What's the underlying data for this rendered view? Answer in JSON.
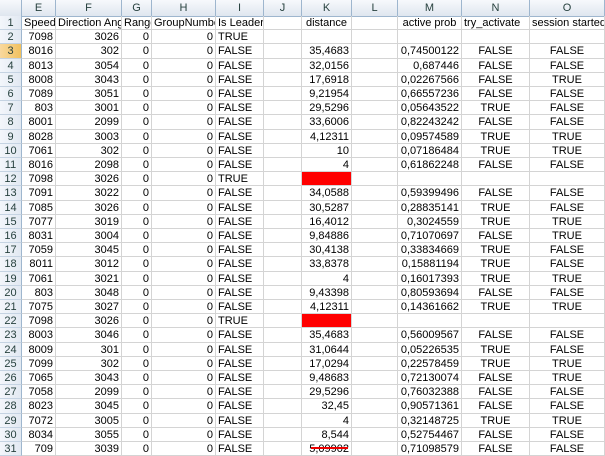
{
  "columns": [
    "E",
    "F",
    "G",
    "H",
    "I",
    "J",
    "K",
    "L",
    "M",
    "N",
    "O"
  ],
  "rows": [
    {
      "n": "1",
      "E": "Speed",
      "F": "Direction Ang",
      "G": "Range",
      "H": "GroupNumber",
      "I": "Is Leader",
      "J": "",
      "K": "distance",
      "L": "",
      "M": "active prob",
      "N": "try_activate",
      "O": "session started",
      "header": true
    },
    {
      "n": "2",
      "E": "7098",
      "F": "3026",
      "G": "0",
      "H": "0",
      "I": "TRUE",
      "J": "",
      "K": "",
      "L": "",
      "M": "",
      "N": "",
      "O": ""
    },
    {
      "n": "3",
      "E": "8016",
      "F": "302",
      "G": "0",
      "H": "0",
      "I": "FALSE",
      "J": "",
      "K": "35,4683",
      "L": "",
      "M": "0,74500122",
      "N": "FALSE",
      "O": "FALSE"
    },
    {
      "n": "4",
      "E": "8013",
      "F": "3054",
      "G": "0",
      "H": "0",
      "I": "FALSE",
      "J": "",
      "K": "32,0156",
      "L": "",
      "M": "0,687446",
      "N": "FALSE",
      "O": "FALSE"
    },
    {
      "n": "5",
      "E": "8008",
      "F": "3043",
      "G": "0",
      "H": "0",
      "I": "FALSE",
      "J": "",
      "K": "17,6918",
      "L": "",
      "M": "0,02267566",
      "N": "FALSE",
      "O": "TRUE"
    },
    {
      "n": "6",
      "E": "7089",
      "F": "3051",
      "G": "0",
      "H": "0",
      "I": "FALSE",
      "J": "",
      "K": "9,21954",
      "L": "",
      "M": "0,66557236",
      "N": "FALSE",
      "O": "FALSE"
    },
    {
      "n": "7",
      "E": "803",
      "F": "3001",
      "G": "0",
      "H": "0",
      "I": "FALSE",
      "J": "",
      "K": "29,5296",
      "L": "",
      "M": "0,05643522",
      "N": "TRUE",
      "O": "FALSE"
    },
    {
      "n": "8",
      "E": "8001",
      "F": "2099",
      "G": "0",
      "H": "0",
      "I": "FALSE",
      "J": "",
      "K": "33,6006",
      "L": "",
      "M": "0,82243242",
      "N": "FALSE",
      "O": "FALSE"
    },
    {
      "n": "9",
      "E": "8028",
      "F": "3003",
      "G": "0",
      "H": "0",
      "I": "FALSE",
      "J": "",
      "K": "4,12311",
      "L": "",
      "M": "0,09574589",
      "N": "TRUE",
      "O": "TRUE"
    },
    {
      "n": "10",
      "E": "7061",
      "F": "302",
      "G": "0",
      "H": "0",
      "I": "FALSE",
      "J": "",
      "K": "10",
      "L": "",
      "M": "0,07186484",
      "N": "TRUE",
      "O": "TRUE"
    },
    {
      "n": "11",
      "E": "8016",
      "F": "2098",
      "G": "0",
      "H": "0",
      "I": "FALSE",
      "J": "",
      "K": "4",
      "L": "",
      "M": "0,61862248",
      "N": "FALSE",
      "O": "FALSE"
    },
    {
      "n": "12",
      "E": "7098",
      "F": "3026",
      "G": "0",
      "H": "0",
      "I": "TRUE",
      "J": "",
      "K": "",
      "L": "",
      "M": "",
      "N": "",
      "O": "",
      "redK": true
    },
    {
      "n": "13",
      "E": "7091",
      "F": "3022",
      "G": "0",
      "H": "0",
      "I": "FALSE",
      "J": "",
      "K": "34,0588",
      "L": "",
      "M": "0,59399496",
      "N": "FALSE",
      "O": "FALSE"
    },
    {
      "n": "14",
      "E": "7085",
      "F": "3026",
      "G": "0",
      "H": "0",
      "I": "FALSE",
      "J": "",
      "K": "30,5287",
      "L": "",
      "M": "0,28835141",
      "N": "TRUE",
      "O": "FALSE"
    },
    {
      "n": "15",
      "E": "7077",
      "F": "3019",
      "G": "0",
      "H": "0",
      "I": "FALSE",
      "J": "",
      "K": "16,4012",
      "L": "",
      "M": "0,3024559",
      "N": "TRUE",
      "O": "TRUE"
    },
    {
      "n": "16",
      "E": "8031",
      "F": "3004",
      "G": "0",
      "H": "0",
      "I": "FALSE",
      "J": "",
      "K": "9,84886",
      "L": "",
      "M": "0,71070697",
      "N": "FALSE",
      "O": "TRUE"
    },
    {
      "n": "17",
      "E": "7059",
      "F": "3045",
      "G": "0",
      "H": "0",
      "I": "FALSE",
      "J": "",
      "K": "30,4138",
      "L": "",
      "M": "0,33834669",
      "N": "TRUE",
      "O": "FALSE"
    },
    {
      "n": "18",
      "E": "8011",
      "F": "3012",
      "G": "0",
      "H": "0",
      "I": "FALSE",
      "J": "",
      "K": "33,8378",
      "L": "",
      "M": "0,15881194",
      "N": "TRUE",
      "O": "FALSE"
    },
    {
      "n": "19",
      "E": "7061",
      "F": "3021",
      "G": "0",
      "H": "0",
      "I": "FALSE",
      "J": "",
      "K": "4",
      "L": "",
      "M": "0,16017393",
      "N": "TRUE",
      "O": "TRUE"
    },
    {
      "n": "20",
      "E": "803",
      "F": "3048",
      "G": "0",
      "H": "0",
      "I": "FALSE",
      "J": "",
      "K": "9,43398",
      "L": "",
      "M": "0,80593694",
      "N": "FALSE",
      "O": "FALSE"
    },
    {
      "n": "21",
      "E": "7075",
      "F": "3027",
      "G": "0",
      "H": "0",
      "I": "FALSE",
      "J": "",
      "K": "4,12311",
      "L": "",
      "M": "0,14361662",
      "N": "TRUE",
      "O": "TRUE"
    },
    {
      "n": "22",
      "E": "7098",
      "F": "3026",
      "G": "0",
      "H": "0",
      "I": "TRUE",
      "J": "",
      "K": "",
      "L": "",
      "M": "",
      "N": "",
      "O": "",
      "redK": true
    },
    {
      "n": "23",
      "E": "8003",
      "F": "3046",
      "G": "0",
      "H": "0",
      "I": "FALSE",
      "J": "",
      "K": "35,4683",
      "L": "",
      "M": "0,56009567",
      "N": "FALSE",
      "O": "FALSE"
    },
    {
      "n": "24",
      "E": "8009",
      "F": "301",
      "G": "0",
      "H": "0",
      "I": "FALSE",
      "J": "",
      "K": "31,0644",
      "L": "",
      "M": "0,05226535",
      "N": "TRUE",
      "O": "FALSE"
    },
    {
      "n": "25",
      "E": "7099",
      "F": "302",
      "G": "0",
      "H": "0",
      "I": "FALSE",
      "J": "",
      "K": "17,0294",
      "L": "",
      "M": "0,22578459",
      "N": "TRUE",
      "O": "TRUE"
    },
    {
      "n": "26",
      "E": "7065",
      "F": "3043",
      "G": "0",
      "H": "0",
      "I": "FALSE",
      "J": "",
      "K": "9,48683",
      "L": "",
      "M": "0,72130074",
      "N": "FALSE",
      "O": "TRUE"
    },
    {
      "n": "27",
      "E": "7058",
      "F": "2099",
      "G": "0",
      "H": "0",
      "I": "FALSE",
      "J": "",
      "K": "29,5296",
      "L": "",
      "M": "0,76032388",
      "N": "FALSE",
      "O": "FALSE"
    },
    {
      "n": "28",
      "E": "8023",
      "F": "3045",
      "G": "0",
      "H": "0",
      "I": "FALSE",
      "J": "",
      "K": "32,45",
      "L": "",
      "M": "0,90571361",
      "N": "FALSE",
      "O": "FALSE"
    },
    {
      "n": "29",
      "E": "7072",
      "F": "3005",
      "G": "0",
      "H": "0",
      "I": "FALSE",
      "J": "",
      "K": "4",
      "L": "",
      "M": "0,32148725",
      "N": "TRUE",
      "O": "TRUE"
    },
    {
      "n": "30",
      "E": "8034",
      "F": "3055",
      "G": "0",
      "H": "0",
      "I": "FALSE",
      "J": "",
      "K": "8,544",
      "L": "",
      "M": "0,52754467",
      "N": "FALSE",
      "O": "FALSE"
    },
    {
      "n": "31",
      "E": "709",
      "F": "3039",
      "G": "0",
      "H": "0",
      "I": "FALSE",
      "J": "",
      "K": "5,09902",
      "L": "",
      "M": "0,71098579",
      "N": "FALSE",
      "O": "FALSE"
    }
  ],
  "colors": {
    "red_fill": "#ff0000",
    "header_bg": "#dfe6ef"
  }
}
